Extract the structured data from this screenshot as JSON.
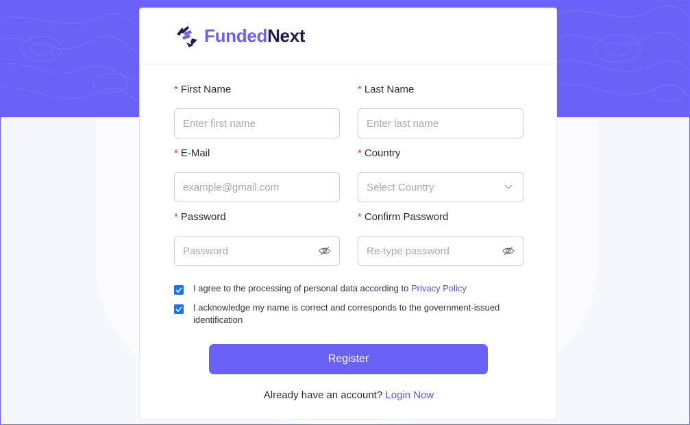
{
  "brand": {
    "name_part1": "Funded",
    "name_part2": "Next",
    "primary_color": "#6a61f7",
    "dark_color": "#1f1c4d"
  },
  "form": {
    "first_name": {
      "label": "First Name",
      "placeholder": "Enter first name"
    },
    "last_name": {
      "label": "Last Name",
      "placeholder": "Enter last name"
    },
    "email": {
      "label": "E-Mail",
      "placeholder": "example@gmail.com"
    },
    "country": {
      "label": "Country",
      "placeholder": "Select Country",
      "icon": "chevron-down-icon"
    },
    "password": {
      "label": "Password",
      "placeholder": "Password",
      "icon": "eye-off-icon"
    },
    "confirm_password": {
      "label": "Confirm Password",
      "placeholder": "Re-type password",
      "icon": "eye-off-icon"
    },
    "required_marker": "*"
  },
  "consents": {
    "privacy_text": "I agree to the processing of personal data according to",
    "privacy_link": "Privacy Policy",
    "privacy_checked": true,
    "identity_text": "I acknowledge my name is correct and corresponds to the government-issued identification",
    "identity_checked": true
  },
  "actions": {
    "register_label": "Register",
    "login_prompt": "Already have an account?",
    "login_link": "Login Now"
  }
}
